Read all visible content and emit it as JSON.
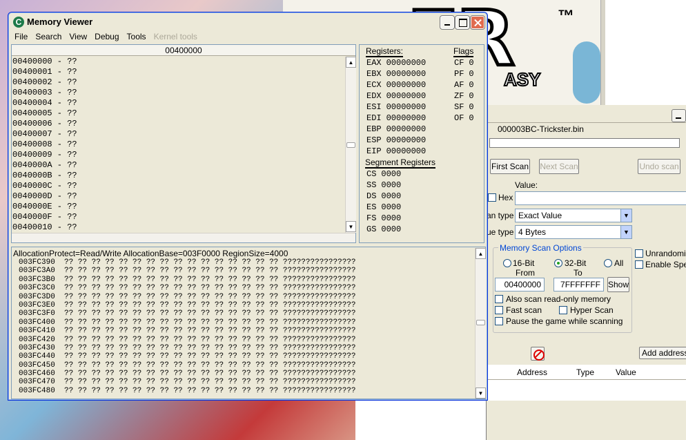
{
  "background": {
    "logo_text": "ER",
    "trademark": "™",
    "subtitle": "ASY"
  },
  "main_window": {
    "process_name": "000003BC-Trickster.bin",
    "first_scan": "First Scan",
    "next_scan": "Next Scan",
    "undo_scan": "Undo scan",
    "value_label": "Value:",
    "hex_label": "Hex",
    "scan_type_label": "an type",
    "scan_type_value": "Exact Value",
    "value_type_label": "ue type",
    "value_type_value": "4 Bytes",
    "memory_scan_options": "Memory Scan Options",
    "radio_16": "16-Bit",
    "radio_32": "32-Bit",
    "radio_all": "All",
    "from_label": "From",
    "to_label": "To",
    "from_value": "00400000",
    "to_value": "7FFFFFFF",
    "show_button": "Show",
    "also_scan_readonly": "Also scan read-only memory",
    "fast_scan": "Fast scan",
    "hyper_scan": "Hyper Scan",
    "pause_game": "Pause the game while scanning",
    "unrandomizer": "Unrandomize",
    "enable_speedhack": "Enable Spee",
    "add_address": "Add address m",
    "columns": {
      "address": "Address",
      "type": "Type",
      "value": "Value"
    }
  },
  "memory_viewer": {
    "title": "Memory Viewer",
    "icon_letter": "C",
    "menu": [
      "File",
      "Search",
      "View",
      "Debug",
      "Tools",
      "Kernel tools"
    ],
    "disasm_header": "00400000",
    "disasm_rows": [
      "00400000 - ??",
      "00400001 - ??",
      "00400002 - ??",
      "00400003 - ??",
      "00400004 - ??",
      "00400005 - ??",
      "00400006 - ??",
      "00400007 - ??",
      "00400008 - ??",
      "00400009 - ??",
      "0040000A - ??",
      "0040000B - ??",
      "0040000C - ??",
      "0040000D - ??",
      "0040000E - ??",
      "0040000F - ??",
      "00400010 - ??"
    ],
    "registers_title": "Registers:",
    "flags_title": "Flags",
    "registers": [
      {
        "name": "EAX",
        "value": "00000000"
      },
      {
        "name": "EBX",
        "value": "00000000"
      },
      {
        "name": "ECX",
        "value": "00000000"
      },
      {
        "name": "EDX",
        "value": "00000000"
      },
      {
        "name": "ESI",
        "value": "00000000"
      },
      {
        "name": "EDI",
        "value": "00000000"
      },
      {
        "name": "EBP",
        "value": "00000000"
      },
      {
        "name": "ESP",
        "value": "00000000"
      },
      {
        "name": "EIP",
        "value": "00000000"
      }
    ],
    "flags": [
      {
        "name": "CF",
        "value": "0"
      },
      {
        "name": "PF",
        "value": "0"
      },
      {
        "name": "AF",
        "value": "0"
      },
      {
        "name": "ZF",
        "value": "0"
      },
      {
        "name": "SF",
        "value": "0"
      },
      {
        "name": "OF",
        "value": "0"
      }
    ],
    "segment_title": "Segment Registers",
    "segments": [
      {
        "name": "CS",
        "value": "0000"
      },
      {
        "name": "SS",
        "value": "0000"
      },
      {
        "name": "DS",
        "value": "0000"
      },
      {
        "name": "ES",
        "value": "0000"
      },
      {
        "name": "FS",
        "value": "0000"
      },
      {
        "name": "GS",
        "value": "0000"
      }
    ],
    "hex_info": "AllocationProtect=Read/Write  AllocationBase=003F0000 RegionSize=4000",
    "hex_bytes": "?? ?? ?? ?? ?? ?? ?? ?? ?? ?? ?? ?? ?? ?? ?? ??",
    "hex_ascii": "????????????????",
    "hex_addresses": [
      "003FC390",
      "003FC3A0",
      "003FC3B0",
      "003FC3C0",
      "003FC3D0",
      "003FC3E0",
      "003FC3F0",
      "003FC400",
      "003FC410",
      "003FC420",
      "003FC430",
      "003FC440",
      "003FC450",
      "003FC460",
      "003FC470",
      "003FC480"
    ]
  }
}
